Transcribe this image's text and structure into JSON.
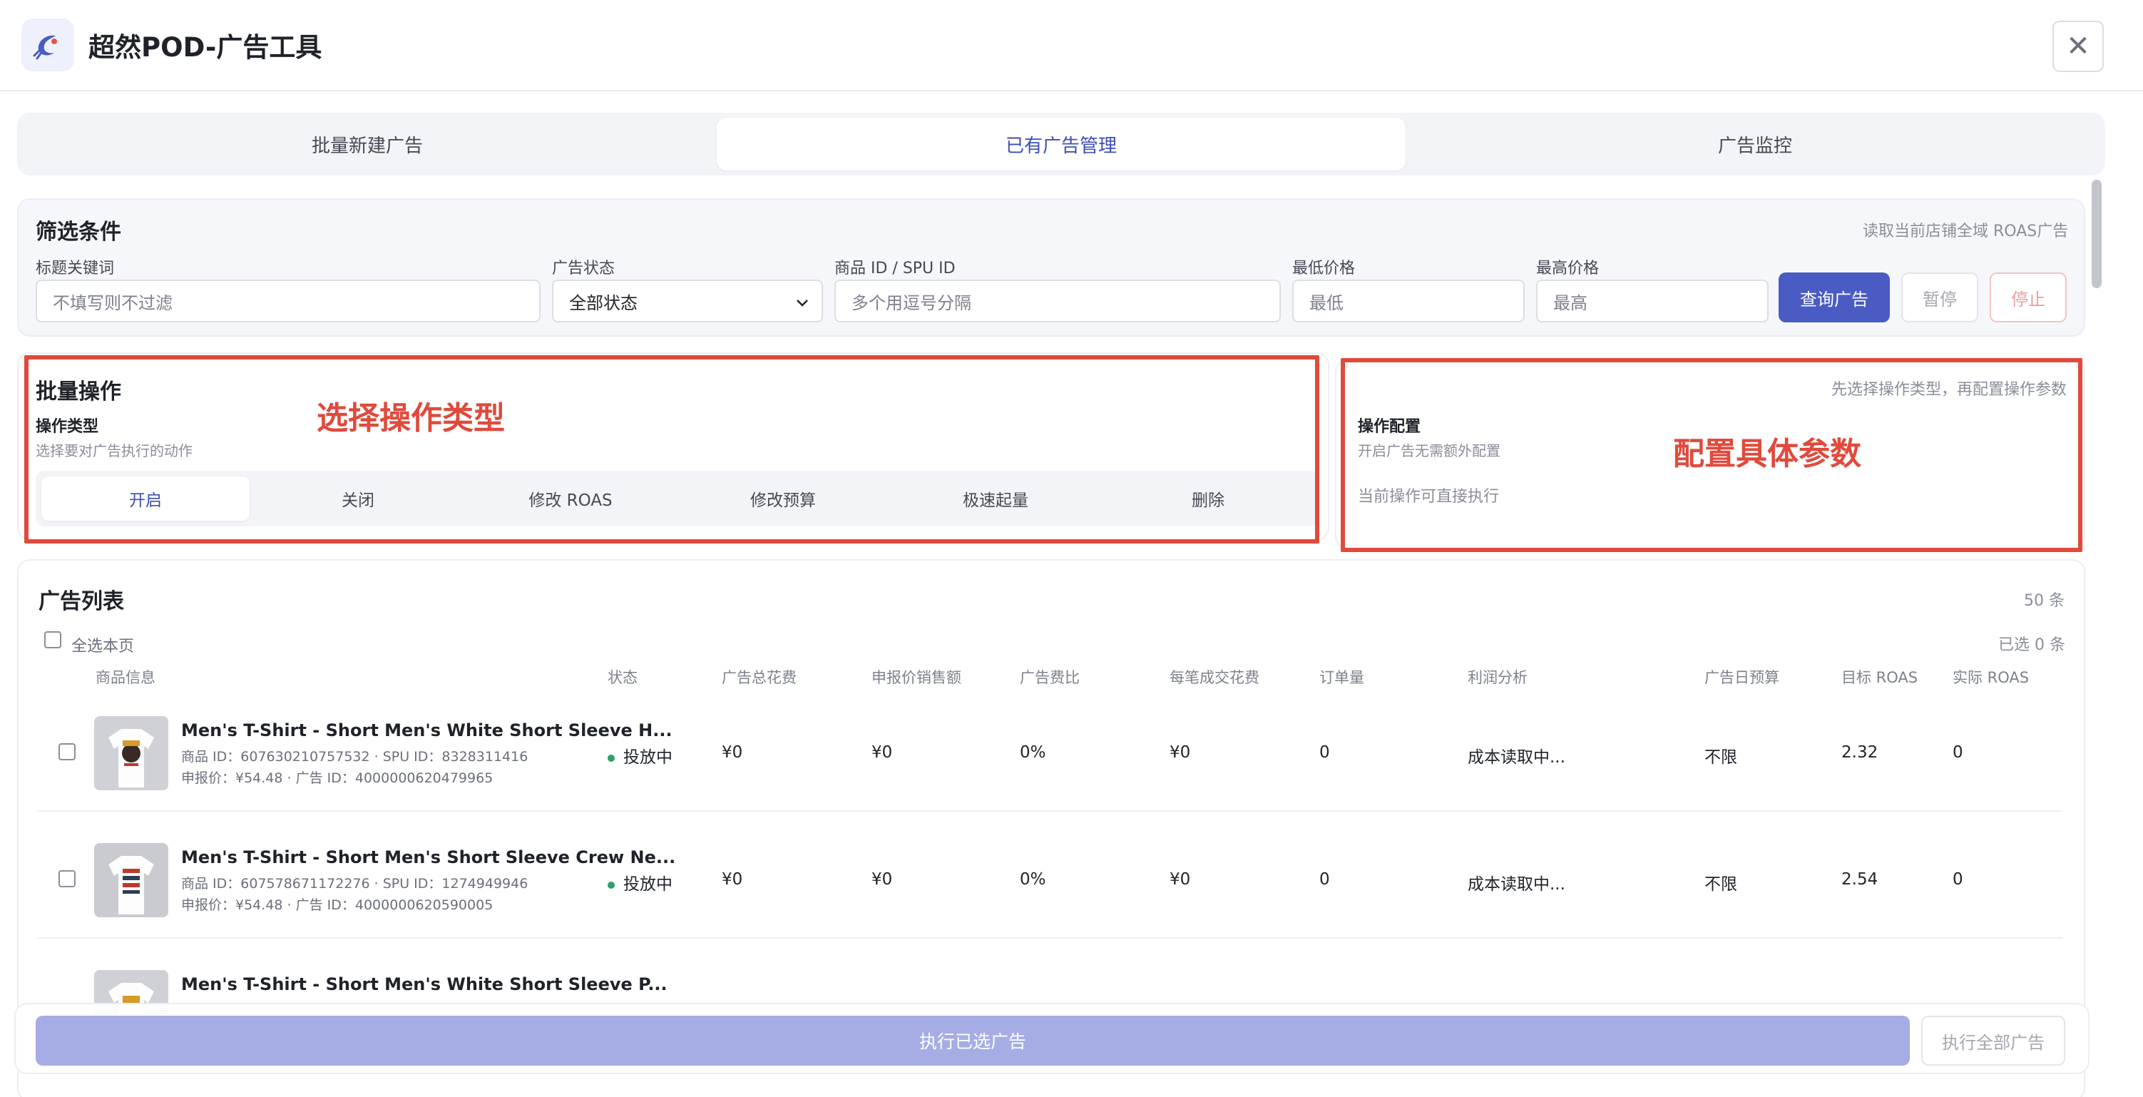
{
  "app": {
    "title": "超然POD-广告工具",
    "logo_icon": "brand-logo-icon",
    "close_symbol": "✕"
  },
  "tabs": [
    {
      "label": "批量新建广告",
      "active": false
    },
    {
      "label": "已有广告管理",
      "active": true
    },
    {
      "label": "广告监控",
      "active": false
    }
  ],
  "filter": {
    "title": "筛选条件",
    "note": "读取当前店铺全域 ROAS广告",
    "keyword_label": "标题关键词",
    "keyword_placeholder": "不填写则不过滤",
    "status_label": "广告状态",
    "status_value": "全部状态",
    "id_label": "商品 ID / SPU ID",
    "id_placeholder": "多个用逗号分隔",
    "min_price_label": "最低价格",
    "min_price_placeholder": "最低",
    "max_price_label": "最高价格",
    "max_price_placeholder": "最高",
    "query_button": "查询广告",
    "pause_button": "暂停",
    "stop_button": "停止"
  },
  "batch": {
    "title": "批量操作",
    "type_label": "操作类型",
    "type_desc": "选择要对广告执行的动作",
    "annotation": "选择操作类型",
    "operations": [
      {
        "label": "开启",
        "active": true
      },
      {
        "label": "关闭",
        "active": false
      },
      {
        "label": "修改 ROAS",
        "active": false
      },
      {
        "label": "修改预算",
        "active": false
      },
      {
        "label": "极速起量",
        "active": false
      },
      {
        "label": "删除",
        "active": false
      }
    ]
  },
  "config": {
    "hint": "先选择操作类型，再配置操作参数",
    "label": "操作配置",
    "desc": "开启广告无需额外配置",
    "annotation": "配置具体参数",
    "status_text": "当前操作可直接执行"
  },
  "list": {
    "title": "广告列表",
    "count": "50 条",
    "select_all": "全选本页",
    "selected": "已选 0 条",
    "headers": [
      "商品信息",
      "状态",
      "广告总花费",
      "申报价销售额",
      "广告费比",
      "每笔成交花费",
      "订单量",
      "利润分析",
      "广告日预算",
      "目标 ROAS",
      "实际 ROAS"
    ],
    "rows": [
      {
        "name": "Men's T-Shirt - Short Men's White Short Sleeve H...",
        "ids": "商品 ID：607630210757532 · SPU ID：8328311416",
        "price": "申报价：¥54.48 · 广告 ID：4000000620479965",
        "status": "投放中",
        "spend": "¥0",
        "sales": "¥0",
        "ratio": "0%",
        "cpa": "¥0",
        "orders": "0",
        "profit": "成本读取中...",
        "budget": "不限",
        "target_roas": "2.32",
        "actual_roas": "0"
      },
      {
        "name": "Men's T-Shirt - Short Men's Short Sleeve Crew Ne...",
        "ids": "商品 ID：607578671172276 · SPU ID：1274949946",
        "price": "申报价：¥54.48 · 广告 ID：4000000620590005",
        "status": "投放中",
        "spend": "¥0",
        "sales": "¥0",
        "ratio": "0%",
        "cpa": "¥0",
        "orders": "0",
        "profit": "成本读取中...",
        "budget": "不限",
        "target_roas": "2.54",
        "actual_roas": "0"
      },
      {
        "name": "Men's T-Shirt - Short Men's White Short Sleeve P..."
      }
    ]
  },
  "footer": {
    "exec_selected": "执行已选广告",
    "exec_all": "执行全部广告"
  }
}
